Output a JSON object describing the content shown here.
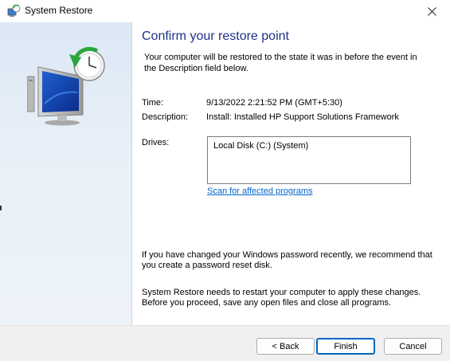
{
  "window": {
    "title": "System Restore",
    "icon": "system-restore-icon",
    "close_icon": "close-icon"
  },
  "heading": "Confirm your restore point",
  "intro": "Your computer will be restored to the state it was in before the event in the Description field below.",
  "details": {
    "time_label": "Time:",
    "time_value": "9/13/2022 2:21:52 PM (GMT+5:30)",
    "description_label": "Description:",
    "description_value": "Install: Installed HP Support Solutions Framework",
    "drives_label": "Drives:",
    "drives": [
      "Local Disk (C:) (System)"
    ]
  },
  "scan_link": "Scan for affected programs",
  "password_note": "If you have changed your Windows password recently, we recommend that you create a password reset disk.",
  "restart_note": "System Restore needs to restart your computer to apply these changes. Before you proceed, save any open files and close all programs.",
  "buttons": {
    "back": "< Back",
    "finish": "Finish",
    "cancel": "Cancel"
  },
  "colors": {
    "heading": "#1e3287",
    "link": "#0066cc",
    "left_pane": "#dce8f5",
    "default_button_border": "#0067c0"
  }
}
